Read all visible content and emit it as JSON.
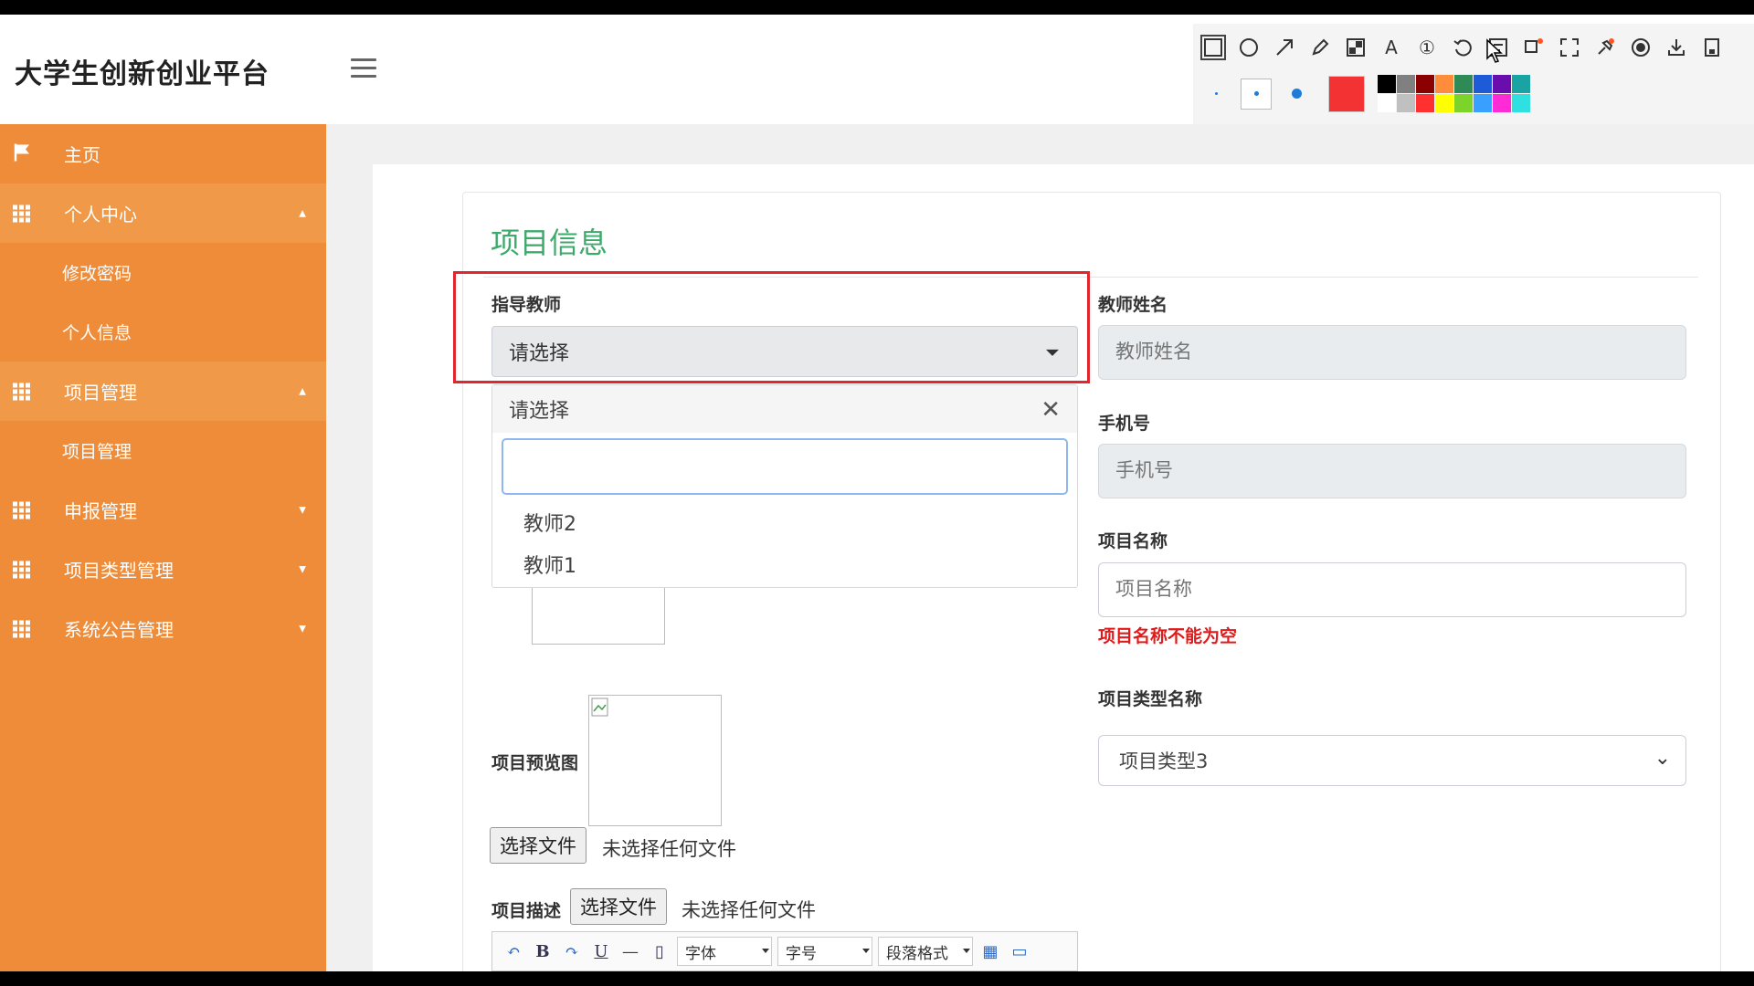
{
  "header": {
    "brand": "大学生创新创业平台"
  },
  "annotation_toolbar": {
    "tools": [
      "rectangle-icon",
      "circle-icon",
      "arrow-icon",
      "pencil-icon",
      "mosaic-icon",
      "text-icon",
      "number-icon",
      "undo-icon",
      "ocr-icon",
      "translate-icon",
      "crop-icon",
      "pin-icon",
      "record-icon",
      "download-icon",
      "save-icon",
      "copy-icon"
    ],
    "text_tool": "A",
    "number_tool": "①",
    "current_color": "#f33333",
    "palette": [
      "#000000",
      "#808080",
      "#8b0000",
      "#ff8c3a",
      "#2e8b57",
      "#1e5bd8",
      "#6a0dad",
      "#1aa3a3",
      "#ffffff",
      "#c0c0c0",
      "#ff3030",
      "#ffff00",
      "#7cd32a",
      "#3aa0ff",
      "#ff2bd6",
      "#2ee0e0"
    ]
  },
  "sidebar": {
    "items": [
      {
        "label": "主页",
        "icon": "flag-icon"
      },
      {
        "label": "个人中心",
        "icon": "grid-icon",
        "expanded": true,
        "children": [
          "修改密码",
          "个人信息"
        ]
      },
      {
        "label": "项目管理",
        "icon": "grid-icon",
        "expanded": true,
        "children": [
          "项目管理"
        ]
      },
      {
        "label": "申报管理",
        "icon": "grid-icon",
        "expanded": false
      },
      {
        "label": "项目类型管理",
        "icon": "grid-icon",
        "expanded": false
      },
      {
        "label": "系统公告管理",
        "icon": "grid-icon",
        "expanded": false
      }
    ]
  },
  "form": {
    "title": "项目信息",
    "advisor": {
      "label": "指导教师",
      "value": "请选择"
    },
    "dropdown": {
      "header": "请选择",
      "search_value": "",
      "options": [
        "教师2",
        "教师1"
      ]
    },
    "teacher_name": {
      "label": "教师姓名",
      "placeholder": "教师姓名"
    },
    "phone": {
      "label": "手机号",
      "placeholder": "手机号"
    },
    "project_name": {
      "label": "项目名称",
      "placeholder": "项目名称",
      "error": "项目名称不能为空"
    },
    "project_type": {
      "label": "项目类型名称",
      "value": "项目类型3"
    },
    "preview": {
      "label": "项目预览图"
    },
    "file_button": "选择文件",
    "file_status": "未选择任何文件",
    "description": {
      "label": "项目描述"
    },
    "editor": {
      "font": "字体",
      "size": "字号",
      "paragraph": "段落格式"
    }
  }
}
